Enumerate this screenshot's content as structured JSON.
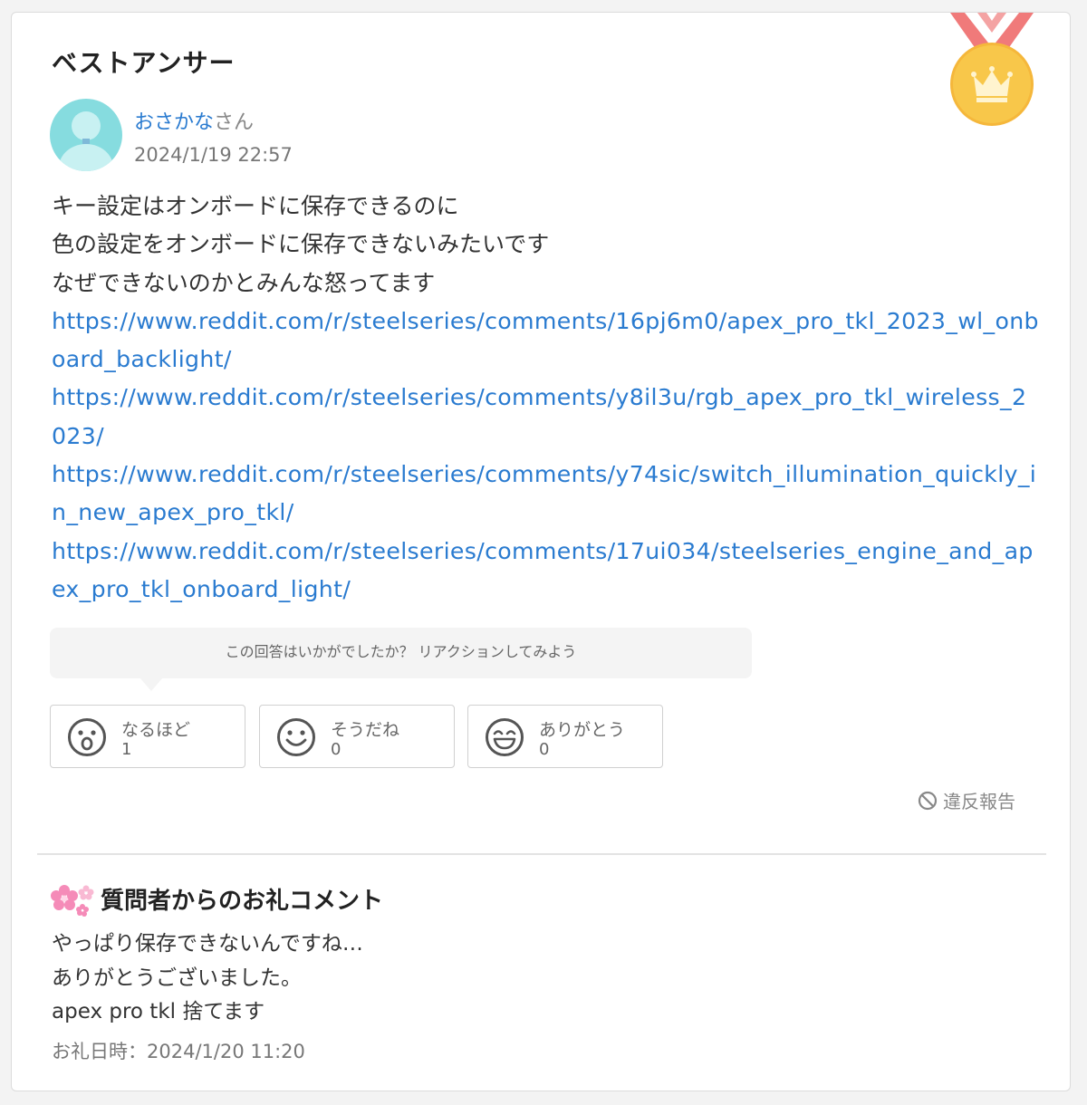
{
  "answer": {
    "title": "ベストアンサー",
    "user_name": "おさかな",
    "user_suffix": "さん",
    "date": "2024/1/19 22:57",
    "body_lines": [
      "キー設定はオンボードに保存できるのに",
      "色の設定をオンボードに保存できないみたいです",
      "なぜできないのかとみんな怒ってます"
    ],
    "links": [
      "https://www.reddit.com/r/steelseries/comments/16pj6m0/apex_pro_tkl_2023_wl_onboard_backlight/",
      "https://www.reddit.com/r/steelseries/comments/y8il3u/rgb_apex_pro_tkl_wireless_2023/",
      "https://www.reddit.com/r/steelseries/comments/y74sic/switch_illumination_quickly_in_new_apex_pro_tkl/",
      "https://www.reddit.com/r/steelseries/comments/17ui034/steelseries_engine_and_apex_pro_tkl_onboard_light/"
    ]
  },
  "reactions": {
    "prompt": "この回答はいかがでしたか？ リアクションしてみよう",
    "items": [
      {
        "label": "なるほど",
        "count": "1",
        "icon": "surprised-face-icon"
      },
      {
        "label": "そうだね",
        "count": "0",
        "icon": "smile-face-icon"
      },
      {
        "label": "ありがとう",
        "count": "0",
        "icon": "grin-face-icon"
      }
    ]
  },
  "report": {
    "label": "違反報告",
    "icon": "prohibited-icon"
  },
  "thanks": {
    "title": "質問者からのお礼コメント",
    "lines": [
      "やっぱり保存できないんですね…",
      "ありがとうございました。",
      "apex pro tkl 捨てます"
    ],
    "date": "お礼日時：2024/1/20 11:20"
  },
  "colors": {
    "link": "#2a7bd0",
    "medal_ribbon": "#f07a7a",
    "medal_gold": "#f8c74a",
    "avatar": "#86dcdf"
  }
}
